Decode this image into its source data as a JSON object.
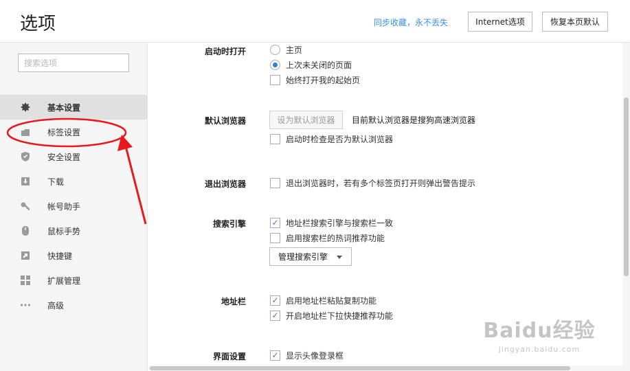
{
  "header": {
    "title": "选项",
    "sync_text": "同步收藏，永不丢失",
    "internet_options_label": "Internet选项",
    "restore_defaults_label": "恢复本页默认"
  },
  "sidebar": {
    "search_placeholder": "搜索选项",
    "active_index": 0,
    "items": [
      {
        "label": "基本设置",
        "icon": "gear-icon"
      },
      {
        "label": "标签设置",
        "icon": "tab-icon"
      },
      {
        "label": "安全设置",
        "icon": "shield-icon"
      },
      {
        "label": "下载",
        "icon": "download-icon"
      },
      {
        "label": "帐号助手",
        "icon": "key-icon"
      },
      {
        "label": "鼠标手势",
        "icon": "mouse-icon"
      },
      {
        "label": "快捷键",
        "icon": "shortcut-arrow-icon"
      },
      {
        "label": "扩展管理",
        "icon": "grid-icon"
      },
      {
        "label": "高级",
        "icon": "more-dots-icon"
      }
    ]
  },
  "sections": {
    "startup": {
      "label": "启动时打开",
      "options": [
        {
          "label": "主页",
          "type": "radio",
          "checked": false
        },
        {
          "label": "上次未关闭的页面",
          "type": "radio",
          "checked": true
        },
        {
          "label": "始终打开我的起始页",
          "type": "checkbox",
          "checked": false
        }
      ]
    },
    "default_browser": {
      "label": "默认浏览器",
      "button_label": "设为默认浏览器",
      "status_text": "目前默认浏览器是搜狗高速浏览器",
      "options": [
        {
          "label": "启动时检查是否为默认浏览器",
          "type": "checkbox",
          "checked": false
        }
      ]
    },
    "exit": {
      "label": "退出浏览器",
      "options": [
        {
          "label": "退出浏览器时，若有多个标签页打开则弹出警告提示",
          "type": "checkbox",
          "checked": false
        }
      ]
    },
    "search_engine": {
      "label": "搜索引擎",
      "options": [
        {
          "label": "地址栏搜索引擎与搜索栏一致",
          "type": "checkbox",
          "checked": true
        },
        {
          "label": "启用搜索栏的热词推荐功能",
          "type": "checkbox",
          "checked": false
        }
      ],
      "dropdown_label": "管理搜索引擎"
    },
    "address_bar": {
      "label": "地址栏",
      "options": [
        {
          "label": "启用地址栏粘贴复制功能",
          "type": "checkbox",
          "checked": true
        },
        {
          "label": "开启地址栏下拉快捷推荐功能",
          "type": "checkbox",
          "checked": true
        }
      ]
    },
    "ui": {
      "label": "界面设置",
      "options": [
        {
          "label": "显示头像登录框",
          "type": "checkbox",
          "checked": true
        }
      ]
    }
  },
  "annotation_color": "#e8181c",
  "accent_color": "#2f7fe0",
  "watermark": {
    "logo": "Baidu经验",
    "url": "jingyan.baidu.com"
  }
}
